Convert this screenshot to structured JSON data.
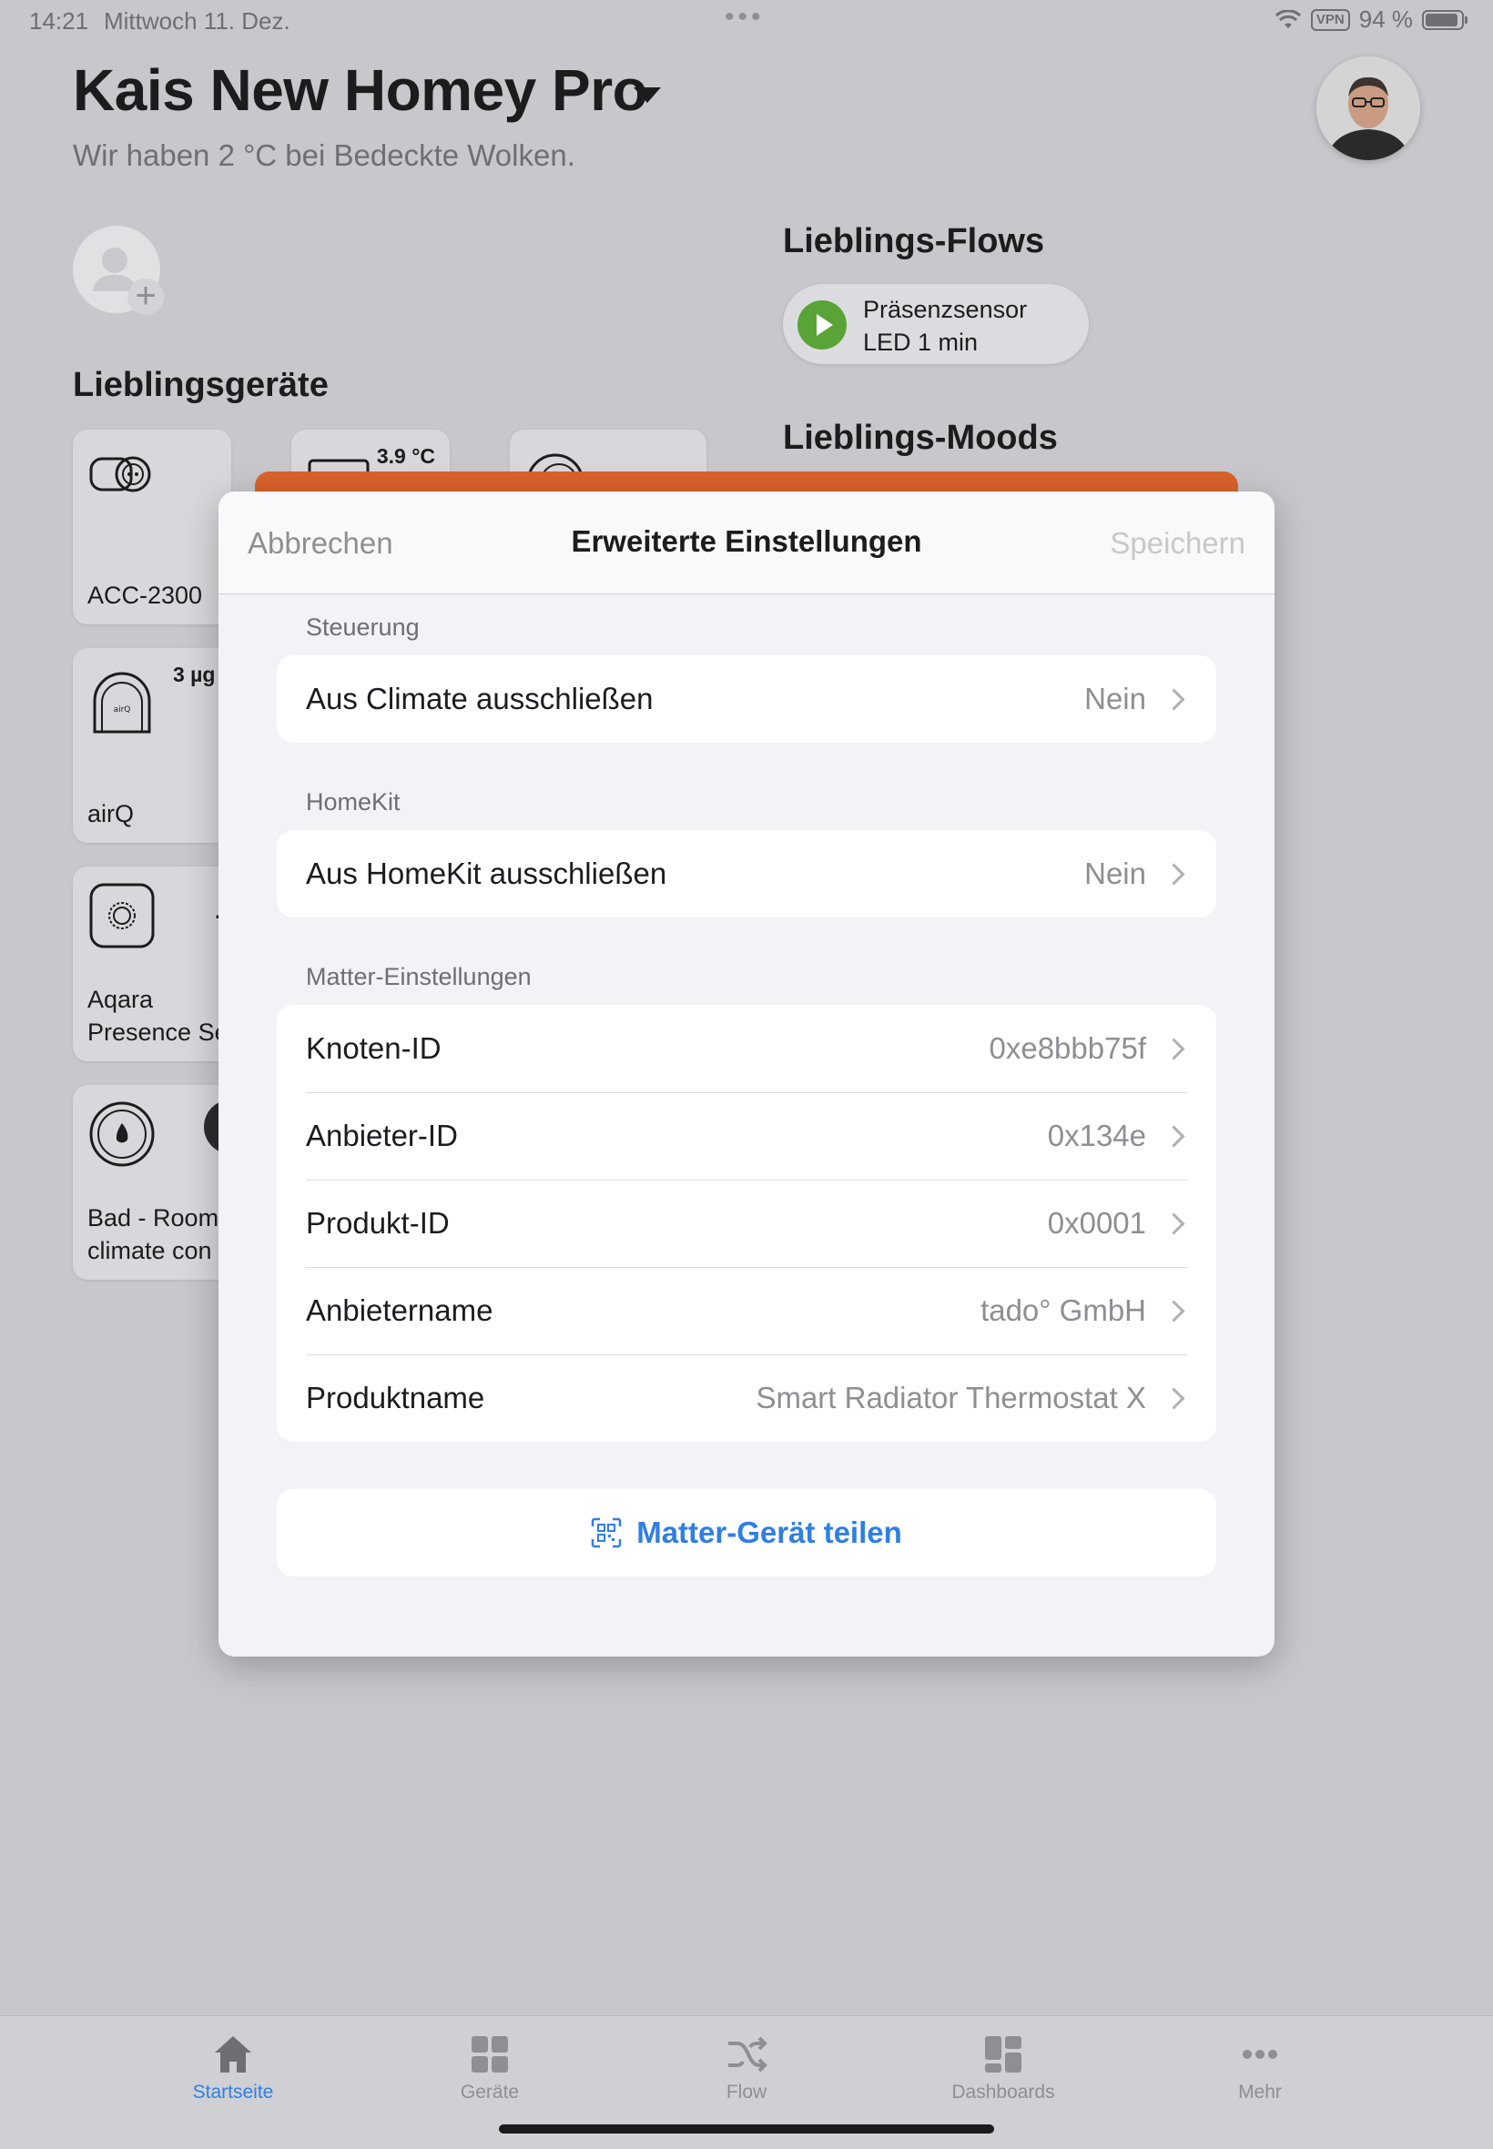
{
  "status_bar": {
    "time": "14:21",
    "date": "Mittwoch 11. Dez.",
    "vpn": "VPN",
    "battery": "94 %",
    "battery_level": 0.94
  },
  "header": {
    "home_name": "Kais New Homey Pro",
    "weather": "Wir haben 2 °C bei Bedeckte Wolken."
  },
  "favorites": {
    "flows_title": "Lieblings-Flows",
    "flow": {
      "line1": "Präsenzsensor",
      "line2": "LED 1 min"
    },
    "moods_title": "Lieblings-Moods",
    "devices_title": "Lieblingsgeräte",
    "devices": [
      {
        "name": "ACC-2300",
        "icon": "smart-plug-icon"
      },
      {
        "value": "3.9 °C",
        "icon": "sensor-icon"
      },
      {
        "icon": "round-device-icon"
      },
      {
        "name": "airQ",
        "value": "3 µg",
        "icon": "air-quality-icon"
      },
      {
        "name_line1": "Aqara",
        "name_line2": "Presence Se",
        "icon": "presence-sensor-icon"
      },
      {
        "name_line1": "Bad - Room",
        "name_line2": "climate con",
        "icon": "thermostat-flame-icon"
      }
    ]
  },
  "modal": {
    "cancel_label": "Abbrechen",
    "title": "Erweiterte Einstellungen",
    "save_label": "Speichern",
    "groups": [
      {
        "label": "Steuerung",
        "rows": [
          {
            "label": "Aus Climate ausschließen",
            "value": "Nein"
          }
        ]
      },
      {
        "label": "HomeKit",
        "rows": [
          {
            "label": "Aus HomeKit ausschließen",
            "value": "Nein"
          }
        ]
      },
      {
        "label": "Matter-Einstellungen",
        "rows": [
          {
            "label": "Knoten-ID",
            "value": "0xe8bbb75f"
          },
          {
            "label": "Anbieter-ID",
            "value": "0x134e"
          },
          {
            "label": "Produkt-ID",
            "value": "0x0001"
          },
          {
            "label": "Anbietername",
            "value": "tado° GmbH"
          },
          {
            "label": "Produktname",
            "value": "Smart Radiator Thermostat X"
          }
        ]
      }
    ],
    "share_label": "Matter-Gerät teilen"
  },
  "tabbar": {
    "tabs": [
      {
        "label": "Startseite",
        "icon": "home-icon",
        "active": true
      },
      {
        "label": "Geräte",
        "icon": "devices-grid-icon",
        "active": false
      },
      {
        "label": "Flow",
        "icon": "flow-shuffle-icon",
        "active": false
      },
      {
        "label": "Dashboards",
        "icon": "dashboards-icon",
        "active": false
      },
      {
        "label": "Mehr",
        "icon": "more-dots-icon",
        "active": false
      }
    ]
  },
  "colors": {
    "accent": "#2f7fe4",
    "flow_play": "#5aa337",
    "orange_card": "#d9622b"
  }
}
